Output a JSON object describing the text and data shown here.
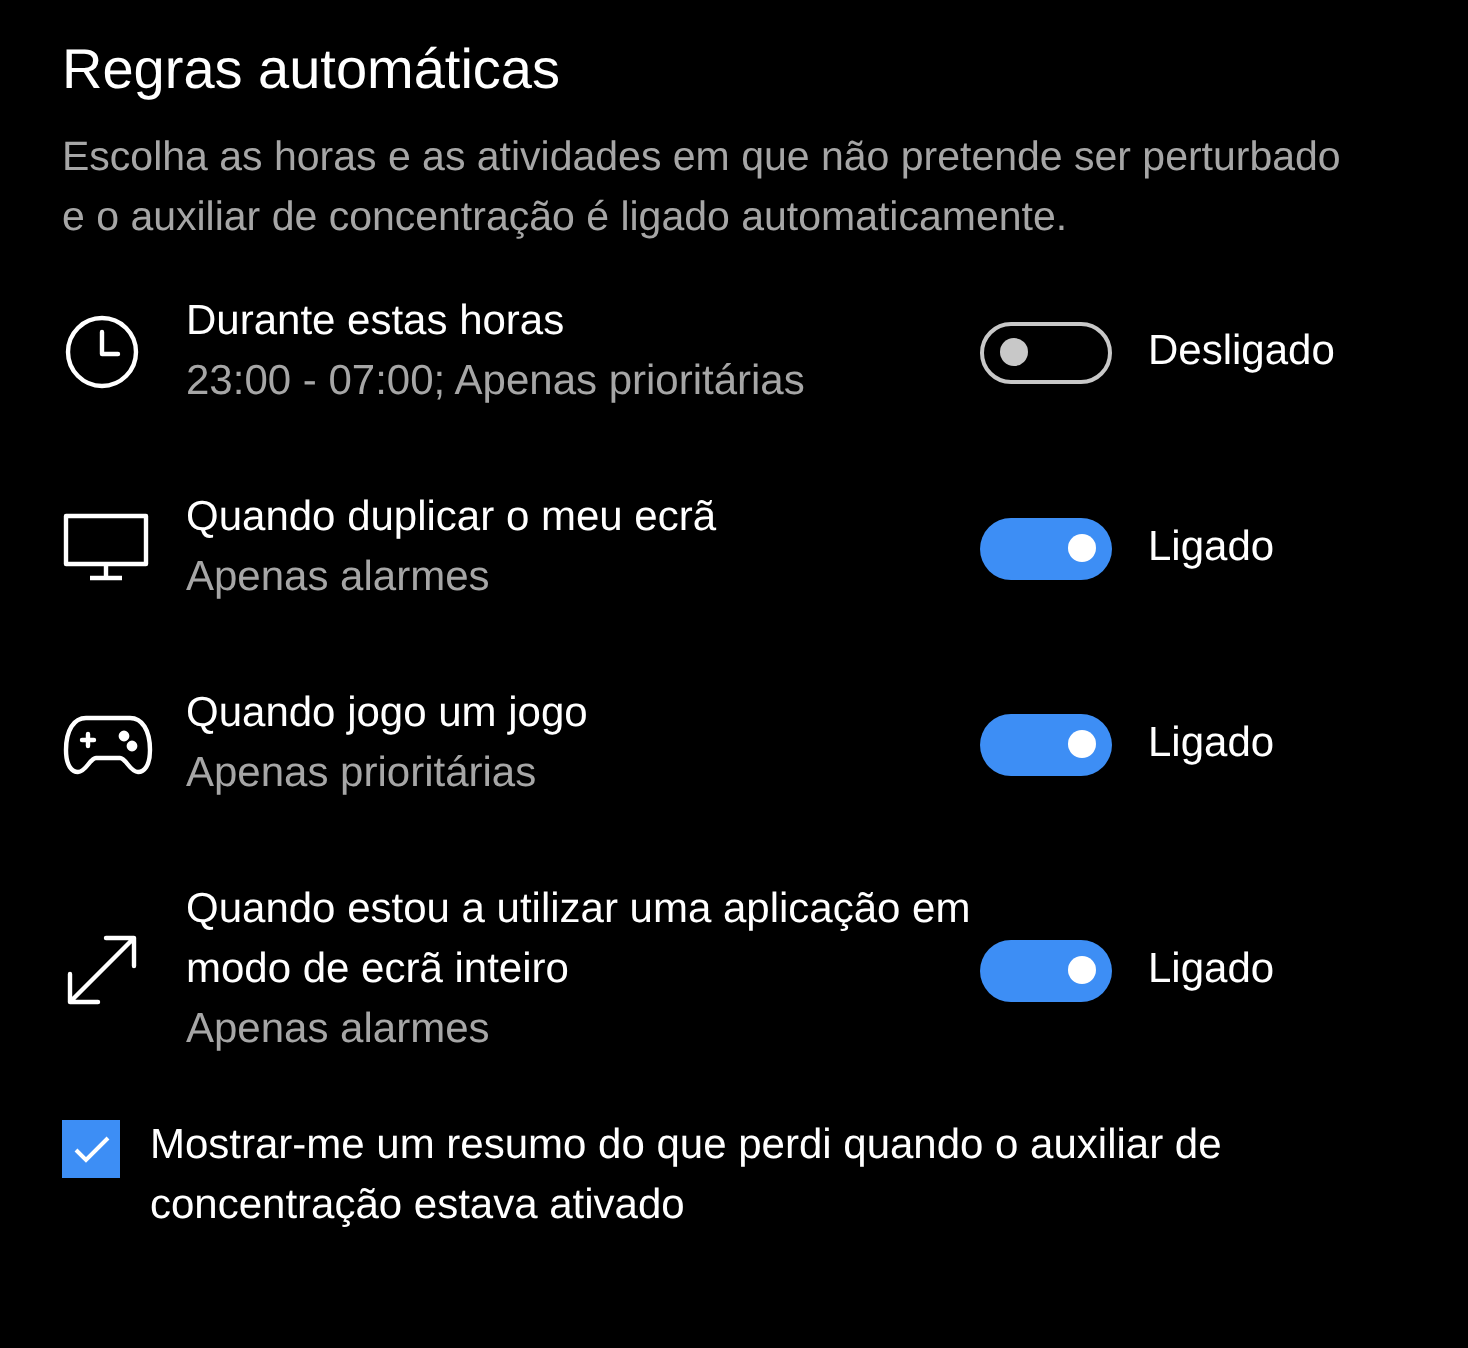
{
  "title": "Regras automáticas",
  "description": "Escolha as horas e as atividades em que não pretende ser perturbado e o auxiliar de concentração é ligado automaticamente.",
  "rules": [
    {
      "kind": "clock",
      "title": "Durante estas horas",
      "subtitle": "23:00 - 07:00; Apenas prioritárias",
      "on": false,
      "state_label": "Desligado"
    },
    {
      "kind": "monitor",
      "title": "Quando duplicar o meu ecrã",
      "subtitle": "Apenas alarmes",
      "on": true,
      "state_label": "Ligado"
    },
    {
      "kind": "gamepad",
      "title": "Quando jogo um jogo",
      "subtitle": "Apenas prioritárias",
      "on": true,
      "state_label": "Ligado"
    },
    {
      "kind": "fullscreen",
      "title": "Quando estou a utilizar uma aplicação em modo de ecrã inteiro",
      "subtitle": "Apenas alarmes",
      "on": true,
      "state_label": "Ligado"
    }
  ],
  "summary_checkbox": {
    "label": "Mostrar-me um resumo do que perdi quando o auxiliar de concentração estava ativado",
    "checked": true
  }
}
